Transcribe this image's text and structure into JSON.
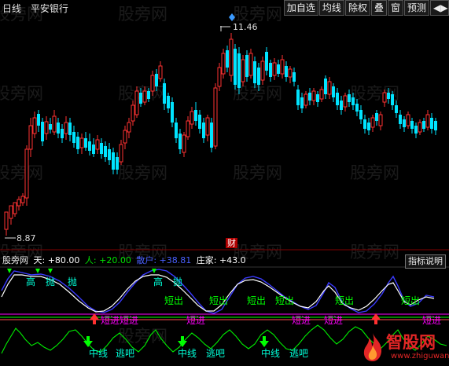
{
  "header": {
    "period": "日线",
    "stock_name": "平安银行"
  },
  "toolbar": {
    "buttons": [
      "加自选",
      "均线",
      "除权",
      "叠",
      "窗",
      "预测"
    ],
    "arrows": "◀▶"
  },
  "watermark": "股旁网",
  "price_labels": {
    "high": "11.46",
    "low": "8.87"
  },
  "indicator": {
    "name": "股旁网",
    "tian": "天: +80.00",
    "ren": "人: +20.00",
    "sanhu": "散户: +38.81",
    "zhuangjia": "庄家: +43.0",
    "help_button": "指标说明"
  },
  "marker_cai": "财",
  "signals": {
    "gao": "高",
    "pao": "抛",
    "duanchu": "短出",
    "duanjin": "短进",
    "zhongxian": "中线",
    "taoba": "逃吧"
  },
  "logo": {
    "main": "智股网",
    "sub": "www.zhiguwang.cn"
  },
  "colors": {
    "up": "#ff3232",
    "down": "#00e4ff",
    "white_line": "#ffffff",
    "blue_line": "#3030ff",
    "green_line": "#00ff00",
    "magenta": "#ff00ff"
  },
  "chart_data": {
    "type": "candlestick",
    "price_max": 11.46,
    "price_min": 8.87
  }
}
